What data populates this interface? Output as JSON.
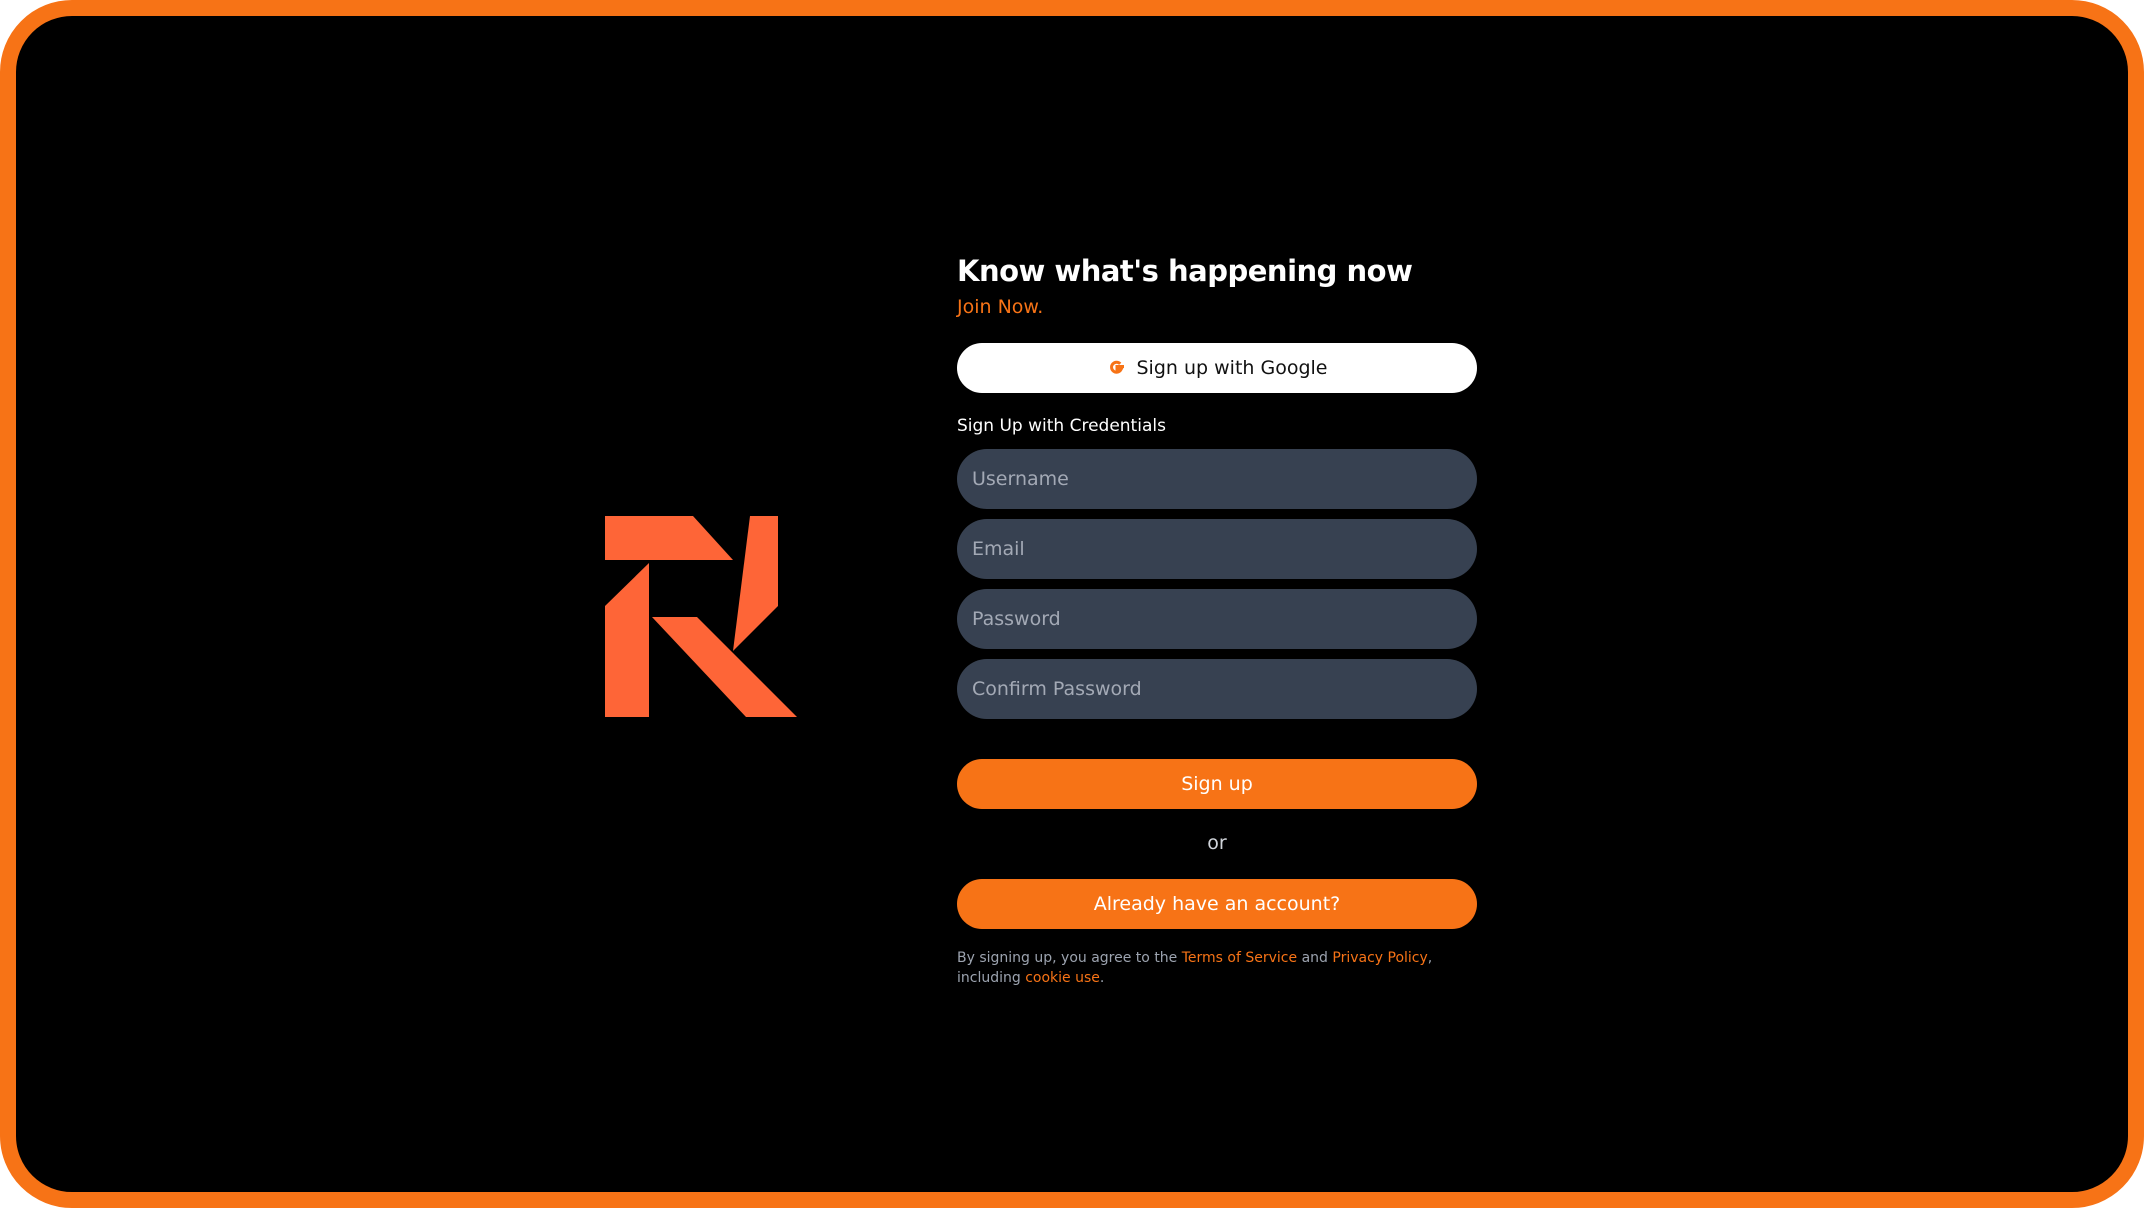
{
  "brand": {
    "logo_icon": "r-logo-icon",
    "accent_color": "#f77316",
    "logo_color": "#fe6537"
  },
  "signup": {
    "headline": "Know what's happening now",
    "subheadline": "Join Now.",
    "google_button_label": "Sign up with Google",
    "google_icon": "google-g-icon",
    "credentials_label": "Sign Up with Credentials",
    "fields": {
      "username_placeholder": "Username",
      "email_placeholder": "Email",
      "password_placeholder": "Password",
      "confirm_password_placeholder": "Confirm Password"
    },
    "signup_button_label": "Sign up",
    "divider_text": "or",
    "login_button_label": "Already have an account?",
    "legal": {
      "prefix": "By signing up, you agree to the ",
      "terms_link": "Terms of Service",
      "and_text": " and ",
      "privacy_link": "Privacy Policy",
      "including_text": ", including ",
      "cookie_link": "cookie use",
      "suffix": "."
    }
  }
}
